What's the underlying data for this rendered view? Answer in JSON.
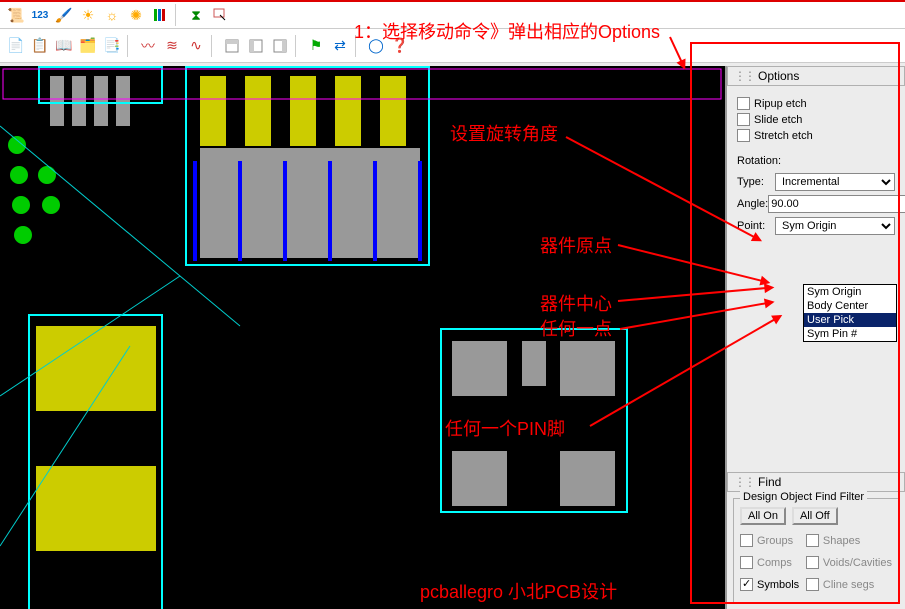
{
  "toolbars": {
    "row1_icons": [
      "script",
      "numbers",
      "paint",
      "sun1",
      "sun2",
      "sun3",
      "layers",
      "hourglass",
      "select"
    ],
    "row2_icons": [
      "new",
      "copy",
      "book",
      "stack",
      "checklist",
      "wave1",
      "wave2",
      "wave3",
      "wave4",
      "wave5",
      "grid1",
      "grid2",
      "grid3",
      "flag",
      "arrows",
      "circle",
      "help"
    ]
  },
  "options_panel": {
    "title": "Options",
    "ripup_etch": "Ripup etch",
    "slide_etch": "Slide etch",
    "stretch_etch": "Stretch etch",
    "rotation_label": "Rotation:",
    "type_label": "Type:",
    "type_value": "Incremental",
    "angle_label": "Angle:",
    "angle_value": "90.00",
    "point_label": "Point:",
    "point_value": "Sym Origin",
    "dropdown_items": [
      "Sym Origin",
      "Body Center",
      "User Pick",
      "Sym Pin #"
    ],
    "dropdown_selected": "User Pick"
  },
  "find_panel": {
    "title": "Find",
    "group_title": "Design Object Find Filter",
    "all_on": "All On",
    "all_off": "All Off",
    "filters": {
      "groups": "Groups",
      "shapes": "Shapes",
      "comps": "Comps",
      "voids": "Voids/Cavities",
      "symbols": "Symbols",
      "clinesegs": "Cline segs"
    },
    "symbols_checked": true
  },
  "annotations": {
    "step1": "1：选择移动命令》弹出相应的Options",
    "rotation_angle": "设置旋转角度",
    "comp_origin": "器件原点",
    "comp_center": "器件中心",
    "any_point": "任何一点",
    "any_pin": "任何一个PIN脚",
    "watermark": "pcballegro 小北PCB设计"
  }
}
